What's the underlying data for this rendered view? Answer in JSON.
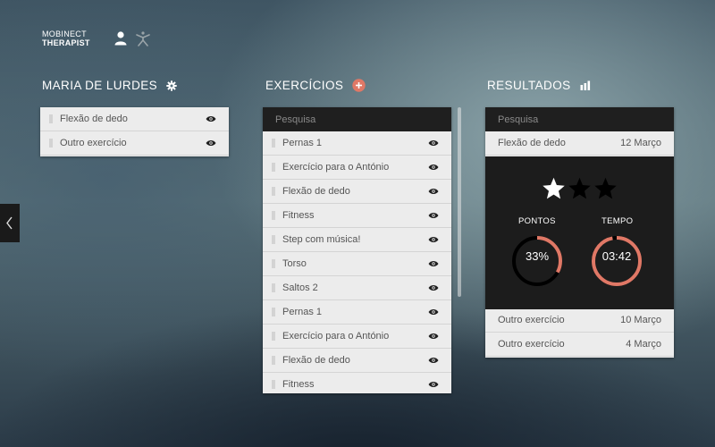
{
  "brand": {
    "line1": "MOBINECT",
    "line2": "THERAPIST"
  },
  "header_icons": [
    "user-icon",
    "exercise-figure-icon"
  ],
  "patient": {
    "title": "MARIA DE LURDES",
    "icon": "gear-icon",
    "items": [
      {
        "label": "Flexão de dedo",
        "icon": "eye-icon"
      },
      {
        "label": "Outro exercício",
        "icon": "eye-icon"
      }
    ]
  },
  "exercises": {
    "title": "EXERCÍCIOS",
    "add_icon": "plus-circle-icon",
    "search_placeholder": "Pesquisa",
    "items": [
      {
        "label": "Pernas 1"
      },
      {
        "label": "Exercício para o António"
      },
      {
        "label": "Flexão de dedo"
      },
      {
        "label": "Fitness"
      },
      {
        "label": "Step com música!"
      },
      {
        "label": "Torso"
      },
      {
        "label": "Saltos 2"
      },
      {
        "label": "Pernas 1"
      },
      {
        "label": "Exercício para o António"
      },
      {
        "label": "Flexão de dedo"
      },
      {
        "label": "Fitness"
      }
    ]
  },
  "results": {
    "title": "RESULTADOS",
    "icon": "bar-chart-icon",
    "search_placeholder": "Pesquisa",
    "selected": {
      "name": "Flexão de dedo",
      "date": "12 Março"
    },
    "detail": {
      "stars_filled": 1,
      "stars_total": 3,
      "points_label": "PONTOS",
      "points_value": "33%",
      "points_progress": 0.33,
      "time_label": "TEMPO",
      "time_value": "03:42",
      "time_progress": 0.97
    },
    "others": [
      {
        "name": "Outro exercício",
        "date": "10 Março"
      },
      {
        "name": "Outro exercício",
        "date": "4 Março"
      }
    ]
  },
  "colors": {
    "accent": "#e07866",
    "panel_bg": "#ececec",
    "dark_bg": "#1c1c1c"
  }
}
